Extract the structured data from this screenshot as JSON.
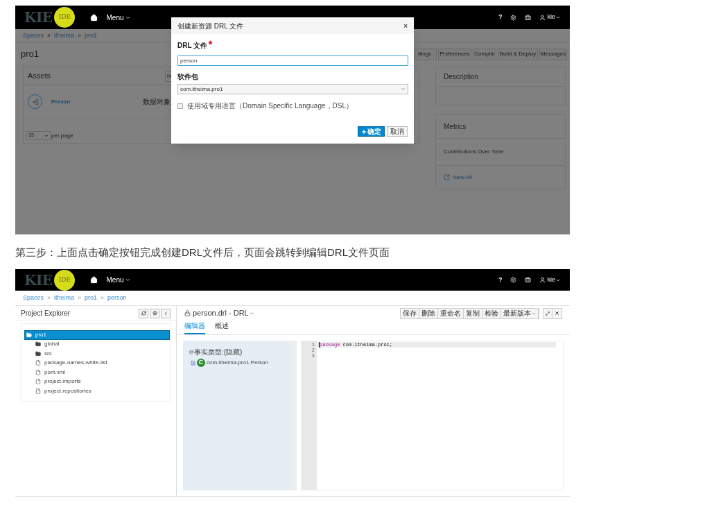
{
  "shot_1": {
    "navbar": {
      "logo": "KIE",
      "logo_badge": "IDE",
      "menu": "Menu",
      "help": "?",
      "user": "kie"
    },
    "breadcrumb": [
      "Spaces",
      "itheima",
      "pro1"
    ],
    "separator": "»",
    "project_title": "pro1",
    "toolbar": [
      "ttings",
      "Preferences",
      "Compile",
      "Build & Deploy",
      "Messages"
    ],
    "assets": {
      "title": "Assets",
      "button": "N",
      "rows": [
        {
          "name": "Person",
          "type": "数据对象"
        }
      ],
      "page_size": "15",
      "per_page": "per page"
    },
    "description": {
      "title": "Description"
    },
    "metrics": {
      "title": "Metrics",
      "subtitle": "Contributions Over Time",
      "link": "View All"
    },
    "dialog": {
      "title": "创建新资源 DRL 文件",
      "close": "×",
      "fields": [
        {
          "kind": "text",
          "label": "DRL 文件",
          "required": true,
          "value": "person"
        },
        {
          "kind": "select",
          "label": "软件包",
          "required": false,
          "value": "com.itheima.pro1"
        }
      ],
      "checkbox": {
        "label": "使用域专用语言（Domain Specific Language，DSL）",
        "checked": false
      },
      "buttons": [
        {
          "kind": "primary",
          "label": "确定"
        },
        {
          "kind": "default",
          "label": "取消"
        }
      ]
    }
  },
  "caption": "第三步：上面点击确定按钮完成创建DRL文件后，页面会跳转到编辑DRL文件页面",
  "shot_2": {
    "navbar": {
      "logo": "KIE",
      "logo_badge": "IDE",
      "menu": "Menu",
      "help": "?",
      "user": "kie"
    },
    "breadcrumb": [
      "Spaces",
      "itheima",
      "pro1",
      "person"
    ],
    "separator": "»",
    "explorer": {
      "title": "Project Explorer",
      "tree": [
        {
          "kind": "folder",
          "label": "pro1",
          "selected": true,
          "children": [
            {
              "kind": "folder",
              "label": "global",
              "selected": false
            },
            {
              "kind": "folder",
              "label": "src",
              "selected": false
            },
            {
              "kind": "file",
              "label": "package-names-white-list",
              "selected": false
            },
            {
              "kind": "file",
              "label": "pom.xml",
              "selected": false
            },
            {
              "kind": "file",
              "label": "project.imports",
              "selected": false
            },
            {
              "kind": "file",
              "label": "project.repositories",
              "selected": false
            }
          ]
        }
      ]
    },
    "editor": {
      "title": "person.drl - DRL",
      "buttons": [
        "保存",
        "删除",
        "重命名",
        "复制",
        "检验",
        "最新版本"
      ],
      "tabs": [
        {
          "label": "编辑器",
          "selected": true
        },
        {
          "label": "概述",
          "selected": false
        }
      ],
      "fact_types": {
        "heading": "事实类型:(隐藏)",
        "items": [
          {
            "badge": "C",
            "name": "com.itheima.pro1.Person"
          }
        ]
      },
      "lines": [
        {
          "number": "1",
          "keyword": "package",
          "code": " com.itheima.pro1;"
        },
        {
          "number": "2"
        },
        {
          "number": "3"
        }
      ]
    }
  }
}
